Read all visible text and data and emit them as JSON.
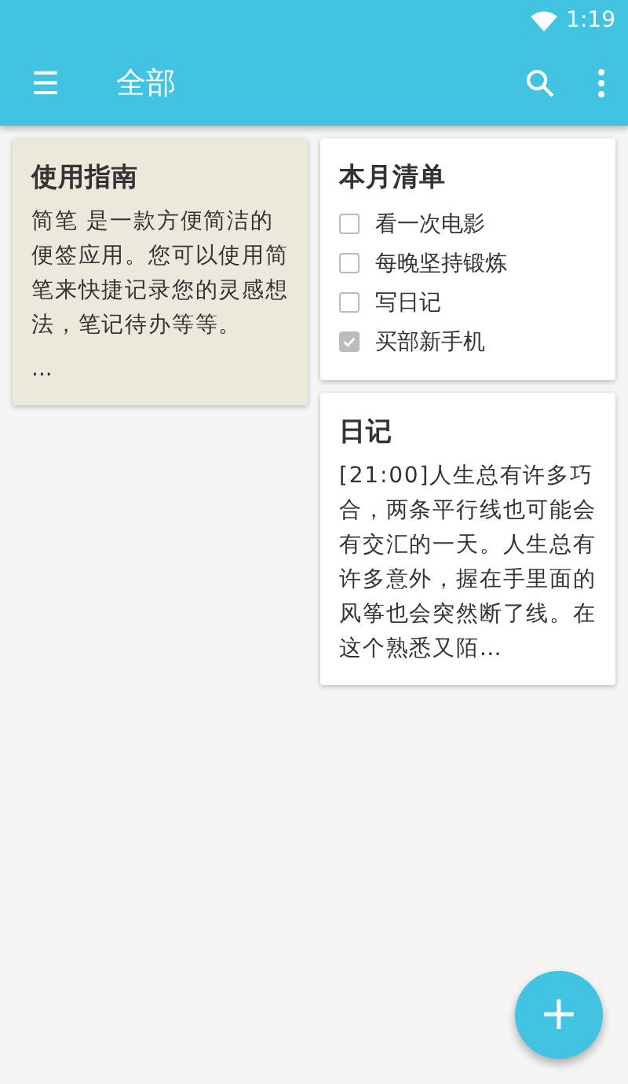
{
  "status_bar": {
    "time": "1:19"
  },
  "toolbar": {
    "menu_icon": "☰",
    "title": "全部"
  },
  "columns": [
    [
      {
        "kind": "text",
        "paper": true,
        "title": "使用指南",
        "body": "简笔 是一款方便简洁的便签应用。您可以使用简笔来快捷记录您的灵感想法，笔记待办等等。",
        "more": "..."
      }
    ],
    [
      {
        "kind": "checklist",
        "paper": false,
        "title": "本月清单",
        "items": [
          {
            "label": "看一次电影",
            "checked": false
          },
          {
            "label": "每晚坚持锻炼",
            "checked": false
          },
          {
            "label": "写日记",
            "checked": false
          },
          {
            "label": "买部新手机",
            "checked": true
          }
        ]
      },
      {
        "kind": "text",
        "paper": false,
        "title": "日记",
        "body": "[21:00]人生总有许多巧合，两条平行线也可能会有交汇的一天。人生总有许多意外，握在手里面的风筝也会突然断了线。在这个熟悉又陌…"
      }
    ]
  ],
  "fab": {
    "label": "+"
  }
}
